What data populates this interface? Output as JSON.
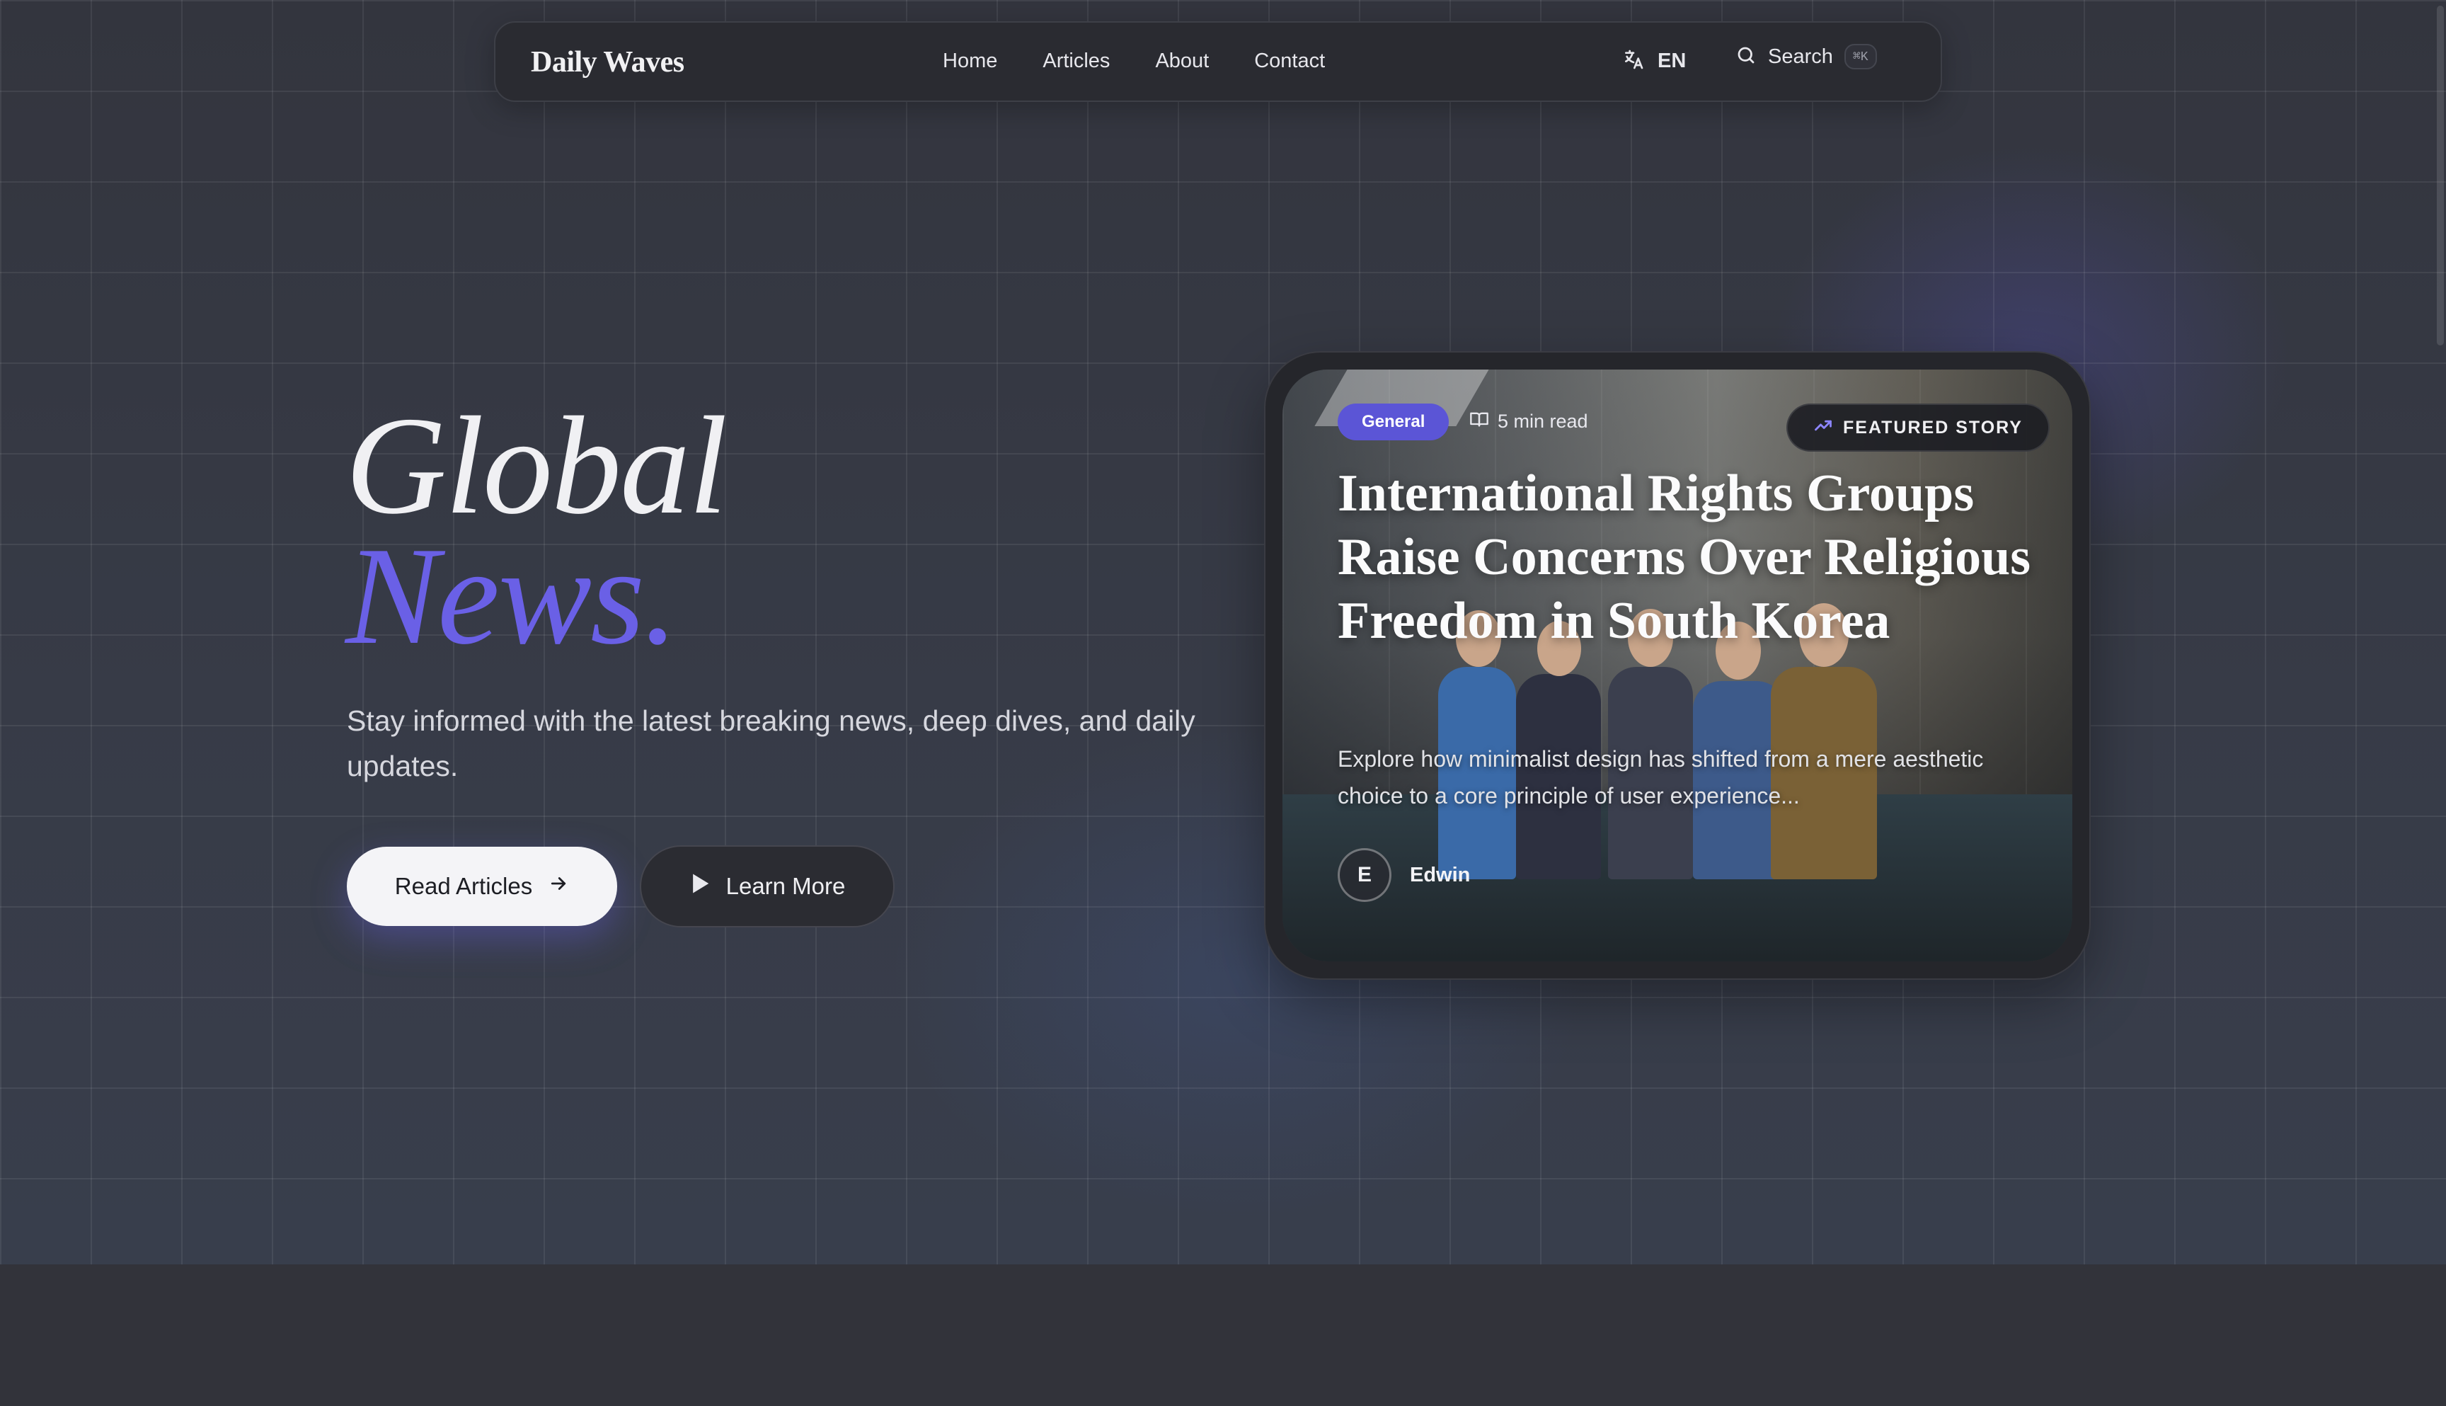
{
  "nav": {
    "logo": "Daily Waves",
    "links": [
      "Home",
      "Articles",
      "About",
      "Contact"
    ],
    "language": "EN",
    "search_label": "Search",
    "search_shortcut": "⌘K"
  },
  "hero": {
    "title_line1": "Global",
    "title_line2": "News.",
    "subtitle": "Stay informed with the latest breaking news, deep dives, and daily updates.",
    "primary_button": "Read Articles",
    "secondary_button": "Learn More",
    "accent_color": "#6a60e6"
  },
  "featured": {
    "category": "General",
    "read_time": "5 min read",
    "badge": "FEATURED STORY",
    "headline": "International Rights Groups Raise Concerns Over Religious Freedom in South Korea",
    "excerpt": "Explore how minimalist design has shifted from a mere aesthetic choice to a core principle of user experience...",
    "author_initial": "E",
    "author_name": "Edwin"
  },
  "icons": {
    "language": "translate-icon",
    "search": "search-icon",
    "arrow": "arrow-right-icon",
    "play": "play-icon",
    "book": "book-open-icon",
    "trend": "trending-up-icon"
  }
}
